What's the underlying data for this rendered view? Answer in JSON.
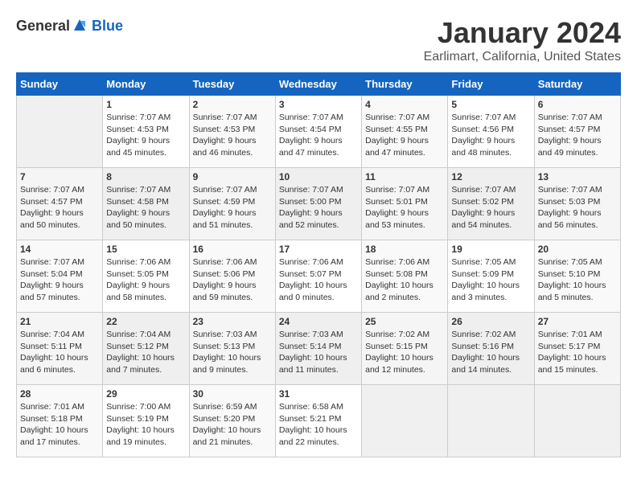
{
  "header": {
    "logo_general": "General",
    "logo_blue": "Blue",
    "month": "January 2024",
    "location": "Earlimart, California, United States"
  },
  "days_of_week": [
    "Sunday",
    "Monday",
    "Tuesday",
    "Wednesday",
    "Thursday",
    "Friday",
    "Saturday"
  ],
  "weeks": [
    [
      {
        "day": "",
        "info": ""
      },
      {
        "day": "1",
        "info": "Sunrise: 7:07 AM\nSunset: 4:53 PM\nDaylight: 9 hours\nand 45 minutes."
      },
      {
        "day": "2",
        "info": "Sunrise: 7:07 AM\nSunset: 4:53 PM\nDaylight: 9 hours\nand 46 minutes."
      },
      {
        "day": "3",
        "info": "Sunrise: 7:07 AM\nSunset: 4:54 PM\nDaylight: 9 hours\nand 47 minutes."
      },
      {
        "day": "4",
        "info": "Sunrise: 7:07 AM\nSunset: 4:55 PM\nDaylight: 9 hours\nand 47 minutes."
      },
      {
        "day": "5",
        "info": "Sunrise: 7:07 AM\nSunset: 4:56 PM\nDaylight: 9 hours\nand 48 minutes."
      },
      {
        "day": "6",
        "info": "Sunrise: 7:07 AM\nSunset: 4:57 PM\nDaylight: 9 hours\nand 49 minutes."
      }
    ],
    [
      {
        "day": "7",
        "info": "Sunrise: 7:07 AM\nSunset: 4:57 PM\nDaylight: 9 hours\nand 50 minutes."
      },
      {
        "day": "8",
        "info": "Sunrise: 7:07 AM\nSunset: 4:58 PM\nDaylight: 9 hours\nand 50 minutes."
      },
      {
        "day": "9",
        "info": "Sunrise: 7:07 AM\nSunset: 4:59 PM\nDaylight: 9 hours\nand 51 minutes."
      },
      {
        "day": "10",
        "info": "Sunrise: 7:07 AM\nSunset: 5:00 PM\nDaylight: 9 hours\nand 52 minutes."
      },
      {
        "day": "11",
        "info": "Sunrise: 7:07 AM\nSunset: 5:01 PM\nDaylight: 9 hours\nand 53 minutes."
      },
      {
        "day": "12",
        "info": "Sunrise: 7:07 AM\nSunset: 5:02 PM\nDaylight: 9 hours\nand 54 minutes."
      },
      {
        "day": "13",
        "info": "Sunrise: 7:07 AM\nSunset: 5:03 PM\nDaylight: 9 hours\nand 56 minutes."
      }
    ],
    [
      {
        "day": "14",
        "info": "Sunrise: 7:07 AM\nSunset: 5:04 PM\nDaylight: 9 hours\nand 57 minutes."
      },
      {
        "day": "15",
        "info": "Sunrise: 7:06 AM\nSunset: 5:05 PM\nDaylight: 9 hours\nand 58 minutes."
      },
      {
        "day": "16",
        "info": "Sunrise: 7:06 AM\nSunset: 5:06 PM\nDaylight: 9 hours\nand 59 minutes."
      },
      {
        "day": "17",
        "info": "Sunrise: 7:06 AM\nSunset: 5:07 PM\nDaylight: 10 hours\nand 0 minutes."
      },
      {
        "day": "18",
        "info": "Sunrise: 7:06 AM\nSunset: 5:08 PM\nDaylight: 10 hours\nand 2 minutes."
      },
      {
        "day": "19",
        "info": "Sunrise: 7:05 AM\nSunset: 5:09 PM\nDaylight: 10 hours\nand 3 minutes."
      },
      {
        "day": "20",
        "info": "Sunrise: 7:05 AM\nSunset: 5:10 PM\nDaylight: 10 hours\nand 5 minutes."
      }
    ],
    [
      {
        "day": "21",
        "info": "Sunrise: 7:04 AM\nSunset: 5:11 PM\nDaylight: 10 hours\nand 6 minutes."
      },
      {
        "day": "22",
        "info": "Sunrise: 7:04 AM\nSunset: 5:12 PM\nDaylight: 10 hours\nand 7 minutes."
      },
      {
        "day": "23",
        "info": "Sunrise: 7:03 AM\nSunset: 5:13 PM\nDaylight: 10 hours\nand 9 minutes."
      },
      {
        "day": "24",
        "info": "Sunrise: 7:03 AM\nSunset: 5:14 PM\nDaylight: 10 hours\nand 11 minutes."
      },
      {
        "day": "25",
        "info": "Sunrise: 7:02 AM\nSunset: 5:15 PM\nDaylight: 10 hours\nand 12 minutes."
      },
      {
        "day": "26",
        "info": "Sunrise: 7:02 AM\nSunset: 5:16 PM\nDaylight: 10 hours\nand 14 minutes."
      },
      {
        "day": "27",
        "info": "Sunrise: 7:01 AM\nSunset: 5:17 PM\nDaylight: 10 hours\nand 15 minutes."
      }
    ],
    [
      {
        "day": "28",
        "info": "Sunrise: 7:01 AM\nSunset: 5:18 PM\nDaylight: 10 hours\nand 17 minutes."
      },
      {
        "day": "29",
        "info": "Sunrise: 7:00 AM\nSunset: 5:19 PM\nDaylight: 10 hours\nand 19 minutes."
      },
      {
        "day": "30",
        "info": "Sunrise: 6:59 AM\nSunset: 5:20 PM\nDaylight: 10 hours\nand 21 minutes."
      },
      {
        "day": "31",
        "info": "Sunrise: 6:58 AM\nSunset: 5:21 PM\nDaylight: 10 hours\nand 22 minutes."
      },
      {
        "day": "",
        "info": ""
      },
      {
        "day": "",
        "info": ""
      },
      {
        "day": "",
        "info": ""
      }
    ]
  ]
}
